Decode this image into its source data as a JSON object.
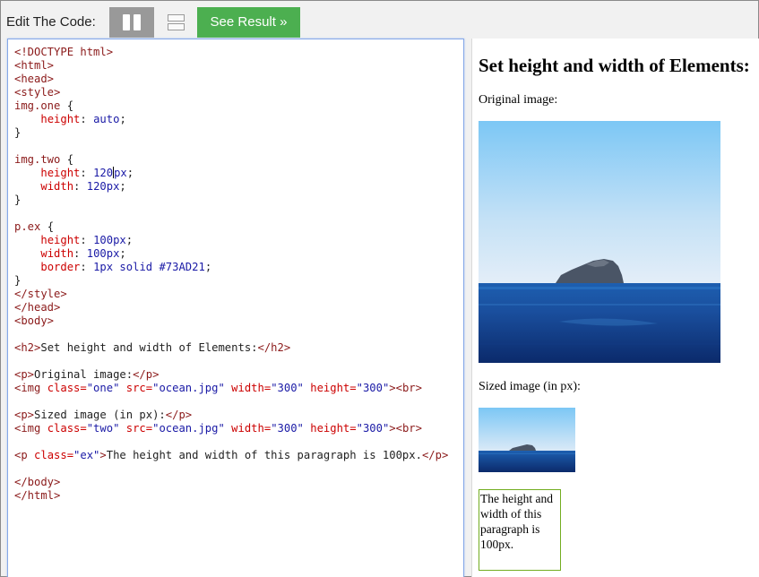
{
  "toolbar": {
    "label": "Edit The Code:",
    "result_button": "See Result »",
    "icons": {
      "layout_vertical": "columns-layout-icon",
      "layout_horizontal": "rows-layout-icon"
    }
  },
  "editor": {
    "lines": [
      [
        [
          "tag",
          "<!DOCTYPE html>"
        ]
      ],
      [
        [
          "tag",
          "<html>"
        ]
      ],
      [
        [
          "tag",
          "<head>"
        ]
      ],
      [
        [
          "tag",
          "<style>"
        ]
      ],
      [
        [
          "sel",
          "img.one"
        ],
        [
          "txt",
          " {"
        ]
      ],
      [
        [
          "txt",
          "    "
        ],
        [
          "prop",
          "height"
        ],
        [
          "txt",
          ": "
        ],
        [
          "val",
          "auto"
        ],
        [
          "txt",
          ";"
        ]
      ],
      [
        [
          "txt",
          "}"
        ]
      ],
      [],
      [
        [
          "sel",
          "img.two"
        ],
        [
          "txt",
          " {"
        ]
      ],
      [
        [
          "txt",
          "    "
        ],
        [
          "prop",
          "height"
        ],
        [
          "txt",
          ": "
        ],
        [
          "val",
          "120"
        ],
        [
          "caret",
          ""
        ],
        [
          "val",
          "px"
        ],
        [
          "txt",
          ";"
        ]
      ],
      [
        [
          "txt",
          "    "
        ],
        [
          "prop",
          "width"
        ],
        [
          "txt",
          ": "
        ],
        [
          "val",
          "120px"
        ],
        [
          "txt",
          ";"
        ]
      ],
      [
        [
          "txt",
          "}"
        ]
      ],
      [],
      [
        [
          "sel",
          "p.ex"
        ],
        [
          "txt",
          " {"
        ]
      ],
      [
        [
          "txt",
          "    "
        ],
        [
          "prop",
          "height"
        ],
        [
          "txt",
          ": "
        ],
        [
          "val",
          "100px"
        ],
        [
          "txt",
          ";"
        ]
      ],
      [
        [
          "txt",
          "    "
        ],
        [
          "prop",
          "width"
        ],
        [
          "txt",
          ": "
        ],
        [
          "val",
          "100px"
        ],
        [
          "txt",
          ";"
        ]
      ],
      [
        [
          "txt",
          "    "
        ],
        [
          "prop",
          "border"
        ],
        [
          "txt",
          ": "
        ],
        [
          "val",
          "1px solid #73AD21"
        ],
        [
          "txt",
          ";"
        ]
      ],
      [
        [
          "txt",
          "}"
        ]
      ],
      [
        [
          "tag",
          "</style>"
        ]
      ],
      [
        [
          "tag",
          "</head>"
        ]
      ],
      [
        [
          "tag",
          "<body>"
        ]
      ],
      [],
      [
        [
          "tag",
          "<h2>"
        ],
        [
          "txt",
          "Set height and width of Elements:"
        ],
        [
          "tag",
          "</h2>"
        ]
      ],
      [],
      [
        [
          "tag",
          "<p>"
        ],
        [
          "txt",
          "Original image:"
        ],
        [
          "tag",
          "</p>"
        ]
      ],
      [
        [
          "tag",
          "<img "
        ],
        [
          "attr",
          "class="
        ],
        [
          "str",
          "\"one\""
        ],
        [
          "txt",
          " "
        ],
        [
          "attr",
          "src="
        ],
        [
          "str",
          "\"ocean.jpg\""
        ],
        [
          "txt",
          " "
        ],
        [
          "attr",
          "width="
        ],
        [
          "str",
          "\"300\""
        ],
        [
          "txt",
          " "
        ],
        [
          "attr",
          "height="
        ],
        [
          "str",
          "\"300\""
        ],
        [
          "tag",
          "><br>"
        ]
      ],
      [],
      [
        [
          "tag",
          "<p>"
        ],
        [
          "txt",
          "Sized image (in px):"
        ],
        [
          "tag",
          "</p>"
        ]
      ],
      [
        [
          "tag",
          "<img "
        ],
        [
          "attr",
          "class="
        ],
        [
          "str",
          "\"two\""
        ],
        [
          "txt",
          " "
        ],
        [
          "attr",
          "src="
        ],
        [
          "str",
          "\"ocean.jpg\""
        ],
        [
          "txt",
          " "
        ],
        [
          "attr",
          "width="
        ],
        [
          "str",
          "\"300\""
        ],
        [
          "txt",
          " "
        ],
        [
          "attr",
          "height="
        ],
        [
          "str",
          "\"300\""
        ],
        [
          "tag",
          "><br>"
        ]
      ],
      [],
      [
        [
          "tag",
          "<p "
        ],
        [
          "attr",
          "class="
        ],
        [
          "str",
          "\"ex\""
        ],
        [
          "tag",
          ">"
        ],
        [
          "txt",
          "The height and width of this paragraph is 100px."
        ],
        [
          "tag",
          "</p>"
        ]
      ],
      [],
      [
        [
          "tag",
          "</body>"
        ]
      ],
      [
        [
          "tag",
          "</html>"
        ]
      ]
    ]
  },
  "result": {
    "heading": "Set height and width of Elements:",
    "p1": "Original image:",
    "p2": "Sized image (in px):",
    "ex_text": "The height and width of this paragraph is 100px.",
    "ex_border_color": "#73AD21"
  }
}
